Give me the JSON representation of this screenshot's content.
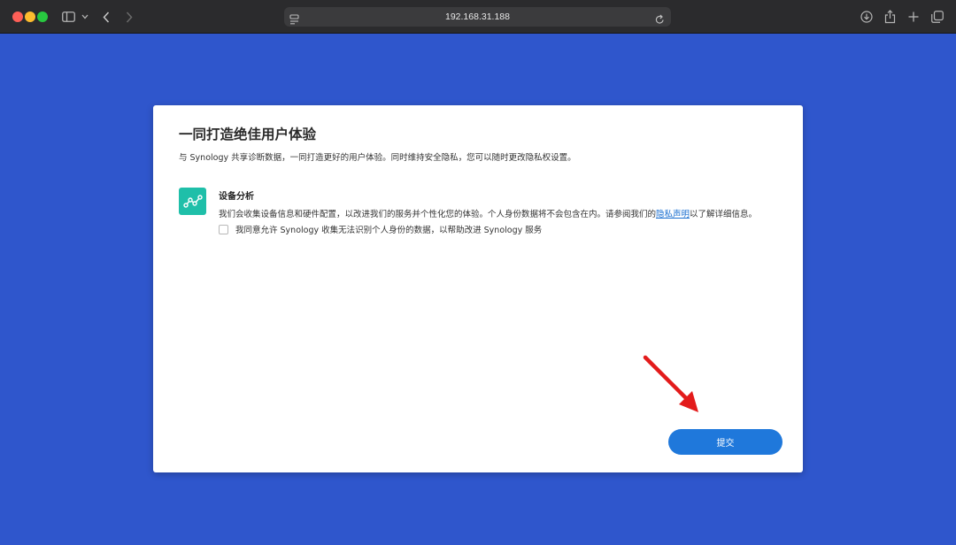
{
  "browser": {
    "url": "192.168.31.188",
    "icons": [
      "sidebar-icon",
      "chevron-down-icon",
      "back-icon",
      "forward-icon",
      "page-settings-icon",
      "reload-icon",
      "download-icon",
      "share-icon",
      "new-tab-icon",
      "tab-overview-icon"
    ]
  },
  "dialog": {
    "title": "一同打造绝佳用户体验",
    "subtitle": "与 Synology 共享诊断数据，一同打造更好的用户体验。同时维持安全隐私，您可以随时更改隐私权设置。",
    "feature": {
      "icon": "analytics-icon",
      "title": "设备分析",
      "desc_before": "我们会收集设备信息和硬件配置，以改进我们的服务并个性化您的体验。个人身份数据将不会包含在内。请参阅我们的",
      "link": "隐私声明",
      "desc_after": "以了解详细信息。",
      "consent_label": "我同意允许 Synology 收集无法识别个人身份的数据，以帮助改进 Synology 服务",
      "consent_checked": false
    },
    "submit_label": "提交"
  },
  "colors": {
    "background": "#2f56cc",
    "accent": "#1f78db",
    "feature_icon_bg": "#1fbfa9",
    "annotation_arrow": "#e31b1b"
  }
}
